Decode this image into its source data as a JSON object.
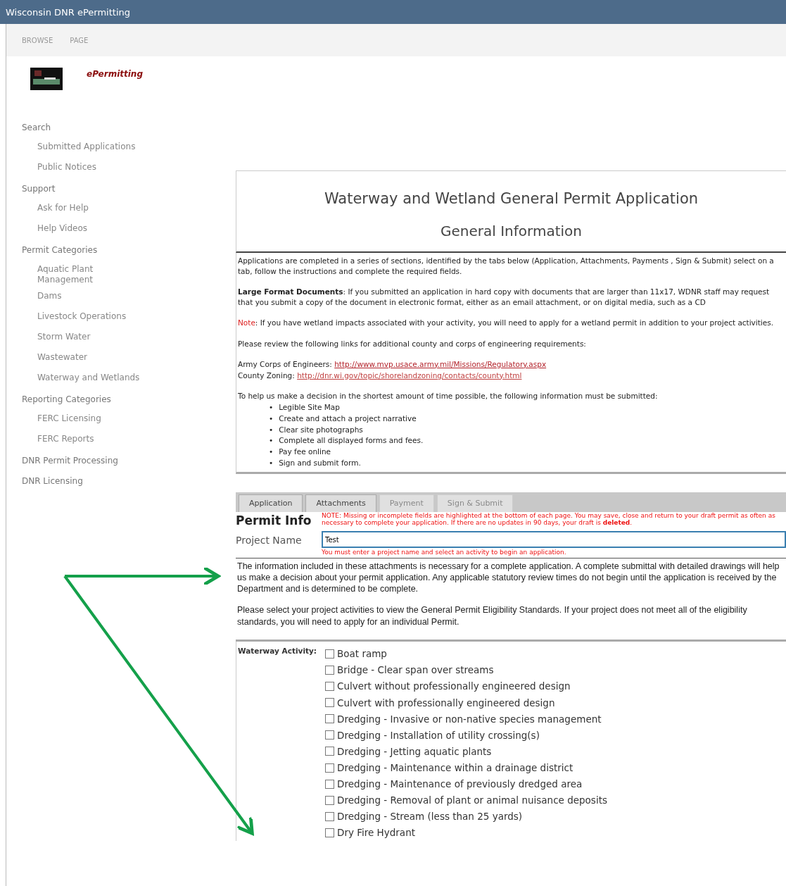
{
  "window": {
    "title": "Wisconsin DNR ePermitting"
  },
  "ribbon_tabs": [
    "BROWSE",
    "PAGE"
  ],
  "brand": {
    "name": "ePermitting"
  },
  "sidebar": {
    "items": [
      {
        "label": "Search",
        "children": [
          {
            "label": "Submitted Applications"
          },
          {
            "label": "Public Notices"
          }
        ]
      },
      {
        "label": "Support",
        "children": [
          {
            "label": "Ask for Help"
          },
          {
            "label": "Help Videos"
          }
        ]
      },
      {
        "label": "Permit Categories",
        "children": [
          {
            "label": "Aquatic Plant Management"
          },
          {
            "label": "Dams"
          },
          {
            "label": "Livestock Operations"
          },
          {
            "label": "Storm Water"
          },
          {
            "label": "Wastewater"
          },
          {
            "label": "Waterway and Wetlands"
          }
        ]
      },
      {
        "label": "Reporting Categories",
        "children": [
          {
            "label": "FERC Licensing"
          },
          {
            "label": "FERC Reports"
          }
        ]
      },
      {
        "label": "DNR Permit Processing"
      },
      {
        "label": "DNR Licensing"
      }
    ]
  },
  "header": {
    "title": "Waterway and Wetland General Permit Application",
    "subtitle": "General Information"
  },
  "intro": {
    "paragraph": "Applications are completed in a series of sections, identified by the tabs below (Application, Attachments, Payments , Sign & Submit) select on a tab, follow the instructions and complete the required fields.",
    "large_format": "**Large Format Documents**: If you submitted an application in hard copy with documents that are larger than 11x17, WDNR staff may request that you submit a copy of the document in electronic format, either as an email attachment, or on digital media, such as a CD",
    "note_label": "Note",
    "note_text": ": If you have wetland impacts associated with your activity, you will need to apply for a wetland permit in addition to your project activities.",
    "links_intro": "Please review the following links for additional county and corps of engineering requirements:",
    "links": [
      {
        "label": "Army Corps of Engineers:",
        "url": "http://www.mvp.usace.army.mil/Missions/Regulatory.aspx"
      },
      {
        "label": "County Zoning:",
        "url": "http://dnr.wi.gov/topic/shorelandzoning/contacts/county.html"
      }
    ],
    "requirements_intro": "To help us make a decision in the shortest amount of time possible, the following information must be submitted:",
    "requirements": [
      {
        "bullet": "•",
        "text": "Legible Site Map"
      },
      {
        "bullet": "•",
        "text": "Create and attach a project narrative"
      },
      {
        "bullet": "•",
        "text": "Clear site photographs"
      },
      {
        "bullet": "•",
        "text": "Complete  all displayed forms and fees."
      },
      {
        "bullet": "•",
        "text": "Pay fee online"
      },
      {
        "bullet": "•",
        "text": "Sign and submit form."
      }
    ]
  },
  "tabs": [
    {
      "label": "Application",
      "disabled": false
    },
    {
      "label": "Attachments",
      "disabled": false
    },
    {
      "label": "Payment",
      "disabled": true
    },
    {
      "label": "Sign & Submit",
      "disabled": true
    }
  ],
  "permit_info": {
    "title": "Permit Info",
    "notice": "NOTE: Missing or incomplete fields are highlighted at the bottom of each page.  You may save, close and return to your draft permit as often as necessary to complete your application.  If there are no updates in 90 days, your draft is **deleted**.",
    "project_name_label": "Project Name",
    "project_name_value": "Test",
    "error": "You must enter a project name and select an activity to begin an application."
  },
  "attachments_text": "The information included in these attachments is necessary for a complete application. A complete submittal with detailed drawings will help us make a decision about your permit application.  Any applicable statutory review times do not begin until the application is received by the Department and is determined to be complete.",
  "eligibility_text": "Please select your project activities to view the General Permit Eligibility Standards.    If your project does not meet all of the eligibility standards, you will need to apply for an individual Permit.",
  "waterway_activity": {
    "label": "Waterway Activity:",
    "options": [
      {
        "label": "Boat ramp",
        "checked": false
      },
      {
        "label": "Bridge - Clear span over streams",
        "checked": false
      },
      {
        "label": "Culvert without professionally engineered design",
        "checked": false
      },
      {
        "label": "Culvert with professionally engineered design",
        "checked": false
      },
      {
        "label": "Dredging - Invasive or non-native species management",
        "checked": false
      },
      {
        "label": "Dredging - Installation of utility crossing(s)",
        "checked": false
      },
      {
        "label": "Dredging - Jetting aquatic plants",
        "checked": false
      },
      {
        "label": "Dredging - Maintenance within a drainage district",
        "checked": false
      },
      {
        "label": "Dredging - Maintenance of previously dredged area",
        "checked": false
      },
      {
        "label": "Dredging - Removal of plant or animal nuisance deposits",
        "checked": false
      },
      {
        "label": "Dredging - Stream (less than 25 yards)",
        "checked": false
      },
      {
        "label": "Dry Fire Hydrant",
        "checked": false
      }
    ]
  }
}
